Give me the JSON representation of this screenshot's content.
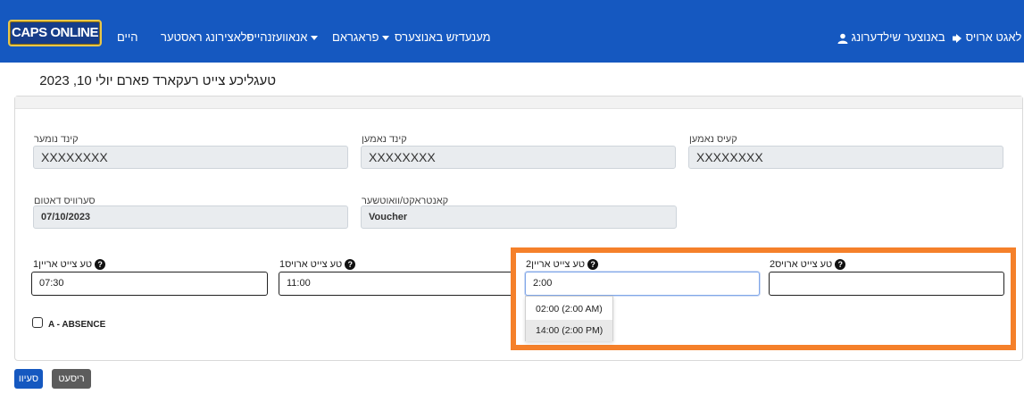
{
  "nav": {
    "logo": "CAPS ONLINE",
    "links": {
      "home": "היים",
      "provider_info": "פלאצירונג ראסטער",
      "announcements": "אנאוועזנהייט",
      "program": "פראגראם",
      "change_provider": "מענעדזש באנוצערס"
    },
    "user_label": "באנוצער שילדערונג",
    "logout_label": "לאגט ארויס"
  },
  "page": {
    "title": "טעגליכע צייט רעקארד פארם  יולי 10, 2023"
  },
  "form": {
    "child_number": {
      "label": "קינד נומער",
      "value": "XXXXXXXX"
    },
    "child_name": {
      "label": "קינד נאמען",
      "value": "XXXXXXXX"
    },
    "case_name": {
      "label": "קעיס נאמען",
      "value": "XXXXXXXX"
    },
    "service_date": {
      "label": "סערוויס דאטום",
      "value": "07/10/2023"
    },
    "contract": {
      "label": "קאנטראקט/וואוטשער",
      "value": "Voucher"
    },
    "time_in_1": {
      "label": "טע צייט אריין1",
      "value": "07:30"
    },
    "time_out_1": {
      "label": "טע צייט ארויס1",
      "value": "11:00"
    },
    "time_in_2": {
      "label": "טע צייט אריין2",
      "value": "2:00"
    },
    "time_out_2": {
      "label": "טע צייט ארויס2",
      "value": ""
    },
    "help_glyph": "?",
    "absence_label": "A - ABSENCE"
  },
  "dropdown": {
    "options": [
      "02:00 (2:00 AM)",
      "14:00 (2:00 PM)"
    ]
  },
  "buttons": {
    "save": "סעיוו",
    "reset": "ריסעט"
  },
  "colors": {
    "navbar": "#1558c0",
    "highlight": "#f5802a",
    "save_button": "#1558c0",
    "reset_button": "#5c5c5c"
  }
}
